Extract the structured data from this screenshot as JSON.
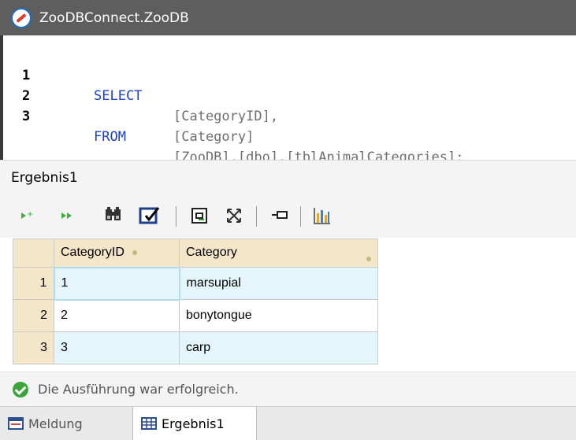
{
  "window": {
    "title": "ZooDBConnect.ZooDB"
  },
  "editor": {
    "lines": [
      {
        "number": "1",
        "keyword": "SELECT",
        "text": "[CategoryID],"
      },
      {
        "number": "2",
        "keyword": "",
        "text": "[Category]"
      },
      {
        "number": "3",
        "keyword": "FROM",
        "text": "[ZooDB].[dbo].[tblAnimalCategories];"
      }
    ]
  },
  "result": {
    "label": "Ergebnis1",
    "toolbar_icons": [
      "execute-step-icon",
      "execute-all-icon",
      "find-icon",
      "edit-results-icon",
      "copy-icon",
      "fit-columns-icon",
      "pin-icon",
      "chart-icon"
    ],
    "columns": [
      "CategoryID",
      "Category"
    ],
    "rows": [
      {
        "num": "1",
        "cells": [
          "1",
          "marsupial"
        ]
      },
      {
        "num": "2",
        "cells": [
          "2",
          "bonytongue"
        ]
      },
      {
        "num": "3",
        "cells": [
          "3",
          "carp"
        ]
      }
    ]
  },
  "status": {
    "message": "Die Ausführung war erfolgreich."
  },
  "tabs": [
    {
      "label": "Meldung",
      "active": false
    },
    {
      "label": "Ergebnis1",
      "active": true
    }
  ],
  "colors": {
    "keyword": "#1b3fd1",
    "header": "#f3e6c9",
    "row_alt": "#e4f6fb",
    "success": "#3aa53a"
  }
}
